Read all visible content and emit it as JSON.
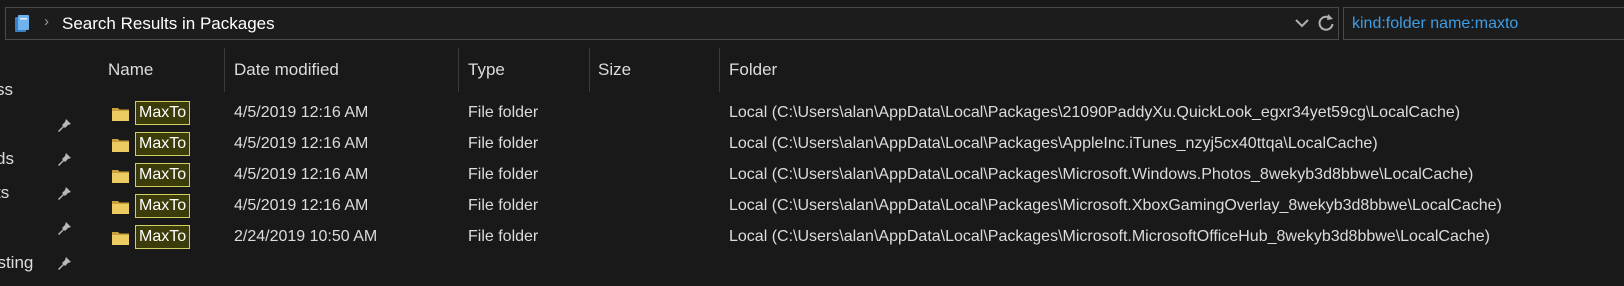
{
  "address": {
    "breadcrumb": "Search Results in Packages"
  },
  "search": {
    "value": "kind:folder name:maxto"
  },
  "sidebar": {
    "items": [
      {
        "label": "ss",
        "pinned": false
      },
      {
        "label": "",
        "pinned": true
      },
      {
        "label": "ds",
        "pinned": true
      },
      {
        "label": "ts",
        "pinned": true
      },
      {
        "label": "",
        "pinned": true
      },
      {
        "label": "esting",
        "pinned": true
      }
    ]
  },
  "columns": {
    "name": "Name",
    "date": "Date modified",
    "type": "Type",
    "size": "Size",
    "folder": "Folder"
  },
  "rows": [
    {
      "name": "MaxTo",
      "date": "4/5/2019 12:16 AM",
      "type": "File folder",
      "size": "",
      "folder": "Local (C:\\Users\\alan\\AppData\\Local\\Packages\\21090PaddyXu.QuickLook_egxr34yet59cg\\LocalCache)"
    },
    {
      "name": "MaxTo",
      "date": "4/5/2019 12:16 AM",
      "type": "File folder",
      "size": "",
      "folder": "Local (C:\\Users\\alan\\AppData\\Local\\Packages\\AppleInc.iTunes_nzyj5cx40ttqa\\LocalCache)"
    },
    {
      "name": "MaxTo",
      "date": "4/5/2019 12:16 AM",
      "type": "File folder",
      "size": "",
      "folder": "Local (C:\\Users\\alan\\AppData\\Local\\Packages\\Microsoft.Windows.Photos_8wekyb3d8bbwe\\LocalCache)"
    },
    {
      "name": "MaxTo",
      "date": "4/5/2019 12:16 AM",
      "type": "File folder",
      "size": "",
      "folder": "Local (C:\\Users\\alan\\AppData\\Local\\Packages\\Microsoft.XboxGamingOverlay_8wekyb3d8bbwe\\LocalCache)"
    },
    {
      "name": "MaxTo",
      "date": "2/24/2019 10:50 AM",
      "type": "File folder",
      "size": "",
      "folder": "Local (C:\\Users\\alan\\AppData\\Local\\Packages\\Microsoft.MicrosoftOfficeHub_8wekyb3d8bbwe\\LocalCache)"
    }
  ],
  "colors": {
    "background": "#191919",
    "search_text": "#3f9de6",
    "highlight_border": "#d0d060",
    "highlight_fill": "#3c3c0a",
    "folder_yellow": "#e8c35a"
  }
}
